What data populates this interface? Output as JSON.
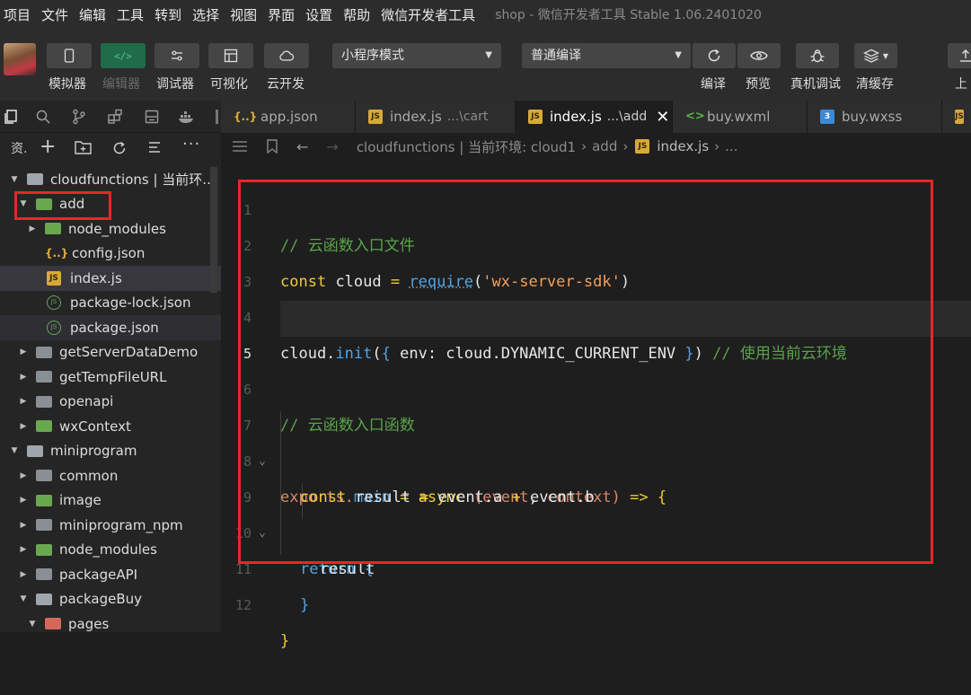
{
  "menu": {
    "items": [
      "项目",
      "文件",
      "编辑",
      "工具",
      "转到",
      "选择",
      "视图",
      "界面",
      "设置",
      "帮助",
      "微信开发者工具"
    ],
    "window_title": "shop - 微信开发者工具 Stable 1.06.2401020"
  },
  "toolbar": {
    "simulator": "模拟器",
    "editor": "编辑器",
    "debugger": "调试器",
    "visual": "可视化",
    "cloud": "云开发",
    "mode_select": "小程序模式",
    "compile_select": "普通编译",
    "compile": "编译",
    "preview": "预览",
    "real_debug": "真机调试",
    "clear_cache": "清缓存",
    "upload": "上"
  },
  "tabs": [
    {
      "name": "app.json",
      "sub": "",
      "icon": "json"
    },
    {
      "name": "index.js",
      "sub": "...\\cart",
      "icon": "js"
    },
    {
      "name": "index.js",
      "sub": "...\\add",
      "icon": "js",
      "active": true
    },
    {
      "name": "buy.wxml",
      "sub": "",
      "icon": "wxml"
    },
    {
      "name": "buy.wxss",
      "sub": "",
      "icon": "wxss"
    }
  ],
  "sidebar": {
    "header_label": "资.",
    "tree": [
      {
        "label": "cloudfunctions | 当前环...",
        "depth": 0,
        "kind": "folder-open"
      },
      {
        "label": "add",
        "depth": 1,
        "kind": "folder-green-open"
      },
      {
        "label": "node_modules",
        "depth": 2,
        "kind": "folder-green"
      },
      {
        "label": "config.json",
        "depth": 2,
        "kind": "json"
      },
      {
        "label": "index.js",
        "depth": 2,
        "kind": "js"
      },
      {
        "label": "package-lock.json",
        "depth": 2,
        "kind": "node"
      },
      {
        "label": "package.json",
        "depth": 2,
        "kind": "node"
      },
      {
        "label": "getServerDataDemo",
        "depth": 1,
        "kind": "folder"
      },
      {
        "label": "getTempFileURL",
        "depth": 1,
        "kind": "folder"
      },
      {
        "label": "openapi",
        "depth": 1,
        "kind": "folder"
      },
      {
        "label": "wxContext",
        "depth": 1,
        "kind": "folder-green"
      },
      {
        "label": "miniprogram",
        "depth": 0,
        "kind": "folder-open"
      },
      {
        "label": "common",
        "depth": 1,
        "kind": "folder"
      },
      {
        "label": "image",
        "depth": 1,
        "kind": "folder-green"
      },
      {
        "label": "miniprogram_npm",
        "depth": 1,
        "kind": "folder"
      },
      {
        "label": "node_modules",
        "depth": 1,
        "kind": "folder-green"
      },
      {
        "label": "packageAPI",
        "depth": 1,
        "kind": "folder"
      },
      {
        "label": "packageBuy",
        "depth": 1,
        "kind": "folder-open"
      },
      {
        "label": "pages",
        "depth": 2,
        "kind": "folder-open"
      }
    ]
  },
  "breadcrumb": {
    "root": "cloudfunctions | 当前环境: cloud1",
    "folder": "add",
    "file": "index.js",
    "tail": "..."
  },
  "code_lines": {
    "l1": "// 云函数入口文件",
    "l2_kw": "const",
    "l2_id": "cloud",
    "l2_op": "=",
    "l2_fn": "require",
    "l2_str": "'wx-server-sdk'",
    "l4_a": "cloud.",
    "l4_fn": "init",
    "l4_b": "env: cloud.DYNAMIC_CURRENT_ENV",
    "l4_cm": "// 使用当前云环境",
    "l6": "// 云函数入口函数",
    "l7_a": "exports.",
    "l7_fn": "main",
    "l7_kw": "async",
    "l7_p1": "event",
    "l7_p2": "context",
    "l8_kw": "const",
    "l8_b": "result",
    "l8_c": "event.a",
    "l8_d": "event.b",
    "l9_kw": "return",
    "l10": "result",
    "numbers": [
      "1",
      "2",
      "3",
      "4",
      "5",
      "6",
      "7",
      "8",
      "9",
      "10",
      "11",
      "12"
    ]
  },
  "colors": {
    "highlight_box": "#e8262a",
    "comment": "#5aa34a",
    "keyword": "#f0c93c",
    "function": "#4fa4e8",
    "string": "#f2a05b"
  }
}
